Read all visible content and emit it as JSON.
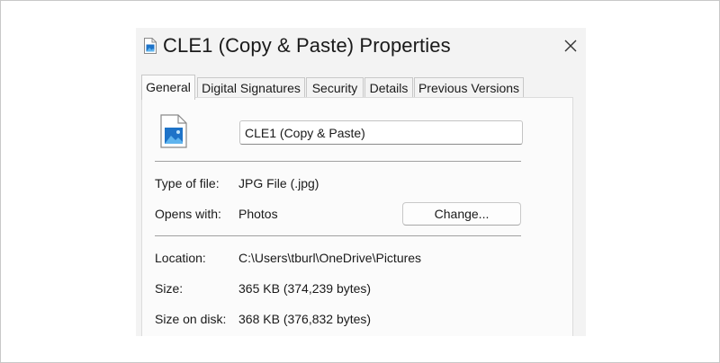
{
  "dialog": {
    "title": "CLE1 (Copy & Paste) Properties",
    "close_glyph": "✕"
  },
  "tabs": [
    {
      "label": "General",
      "active": true
    },
    {
      "label": "Digital Signatures",
      "active": false
    },
    {
      "label": "Security",
      "active": false
    },
    {
      "label": "Details",
      "active": false
    },
    {
      "label": "Previous Versions",
      "active": false
    }
  ],
  "general": {
    "file_name": "CLE1 (Copy & Paste)",
    "type_label": "Type of file:",
    "type_value": "JPG File (.jpg)",
    "opens_label": "Opens with:",
    "opens_value": "Photos",
    "change_button": "Change...",
    "location_label": "Location:",
    "location_value": "C:\\Users\\tburl\\OneDrive\\Pictures",
    "size_label": "Size:",
    "size_value": "365 KB (374,239 bytes)",
    "size_on_disk_label": "Size on disk:",
    "size_on_disk_value": "368 KB (376,832 bytes)"
  },
  "icons": {
    "title": "image-file-icon",
    "file": "image-file-icon",
    "close": "close-icon"
  },
  "colors": {
    "dialog_bg": "#f3f3f3",
    "panel_bg": "#fbfbfb",
    "icon_blue": "#1e73c8",
    "icon_light_blue": "#5fb4ee"
  }
}
